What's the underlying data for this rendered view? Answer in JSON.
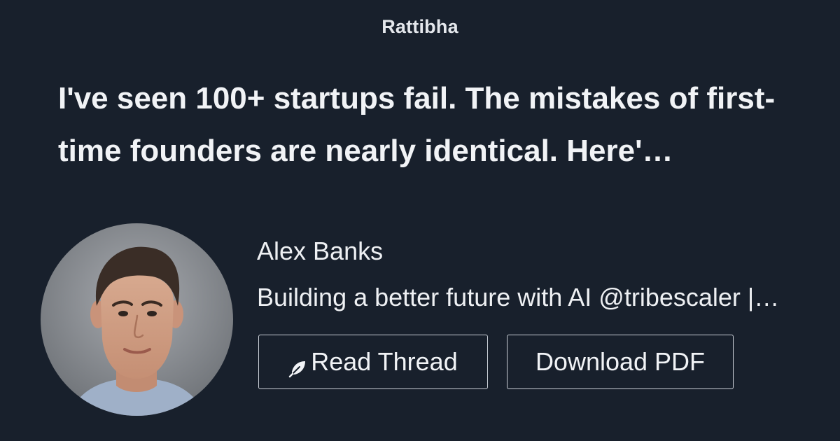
{
  "brand": "Rattibha",
  "thread": {
    "title": "I've seen 100+ startups fail. The mistakes of first-time founders are nearly identical. Here'…"
  },
  "author": {
    "name": "Alex Banks",
    "bio": "Building a better future with AI @tribescaler |…"
  },
  "actions": {
    "read_label": "Read Thread",
    "read_icon": "feather-icon",
    "pdf_label": "Download PDF"
  },
  "colors": {
    "background": "#18202c",
    "text": "#eef0f3",
    "button_border": "#c9ced6"
  }
}
